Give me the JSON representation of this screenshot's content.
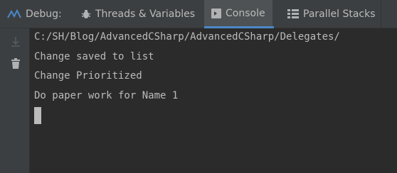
{
  "toolbar": {
    "debug_label": "Debug:",
    "tabs": [
      {
        "label": "Threads & Variables",
        "icon": "bug-icon"
      },
      {
        "label": "Console",
        "icon": "console-icon",
        "active": true
      },
      {
        "label": "Parallel Stacks",
        "icon": "parallel-stacks-icon"
      }
    ]
  },
  "gutter": {
    "icons": [
      "scroll-to-end-icon",
      "trash-icon"
    ]
  },
  "console": {
    "lines": [
      "C:/SH/Blog/AdvancedCSharp/AdvancedCSharp/Delegates/",
      "Change saved to list",
      "Change Prioritized",
      "Do paper work for Name 1"
    ]
  },
  "colors": {
    "background": "#2b2b2b",
    "toolbar": "#3c3f41",
    "active_tab": "#4e5254",
    "accent": "#4a88c7",
    "text": "#bbbbbb"
  }
}
